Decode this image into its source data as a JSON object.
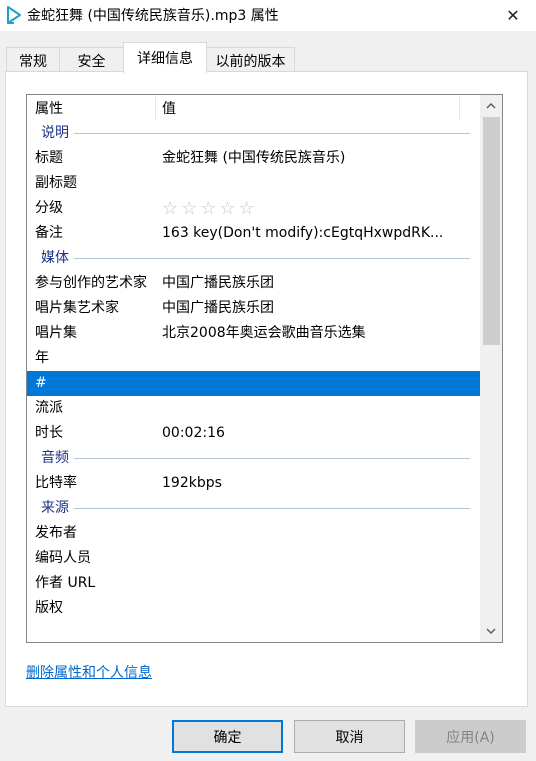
{
  "window": {
    "title": "金蛇狂舞 (中国传统民族音乐).mp3 属性",
    "close_glyph": "✕"
  },
  "tabs": [
    {
      "label": "常规",
      "active": false
    },
    {
      "label": "安全",
      "active": false
    },
    {
      "label": "详细信息",
      "active": true
    },
    {
      "label": "以前的版本",
      "active": false
    }
  ],
  "list": {
    "columns": {
      "property": "属性",
      "value": "值"
    },
    "groups": {
      "description": "说明",
      "media": "媒体",
      "audio": "音频",
      "origin": "来源"
    },
    "rows": {
      "title": {
        "k": "标题",
        "v": "金蛇狂舞 (中国传统民族音乐)"
      },
      "subtitle": {
        "k": "副标题",
        "v": ""
      },
      "rating": {
        "k": "分级",
        "stars": "☆☆☆☆☆"
      },
      "comments": {
        "k": "备注",
        "v": "163 key(Don't modify):cEgtqHxwpdRK..."
      },
      "contributing_artists": {
        "k": "参与创作的艺术家",
        "v": "中国广播民族乐团"
      },
      "album_artist": {
        "k": "唱片集艺术家",
        "v": "中国广播民族乐团"
      },
      "album": {
        "k": "唱片集",
        "v": "北京2008年奥运会歌曲音乐选集"
      },
      "year": {
        "k": "年",
        "v": ""
      },
      "track": {
        "k": "#",
        "v": ""
      },
      "genre": {
        "k": "流派",
        "v": ""
      },
      "length": {
        "k": "时长",
        "v": "00:02:16"
      },
      "bitrate": {
        "k": "比特率",
        "v": "192kbps"
      },
      "publisher": {
        "k": "发布者",
        "v": ""
      },
      "encoded_by": {
        "k": "编码人员",
        "v": ""
      },
      "author_url": {
        "k": "作者 URL",
        "v": ""
      },
      "copyright": {
        "k": "版权",
        "v": ""
      }
    }
  },
  "link": {
    "remove_properties": "删除属性和个人信息"
  },
  "buttons": {
    "ok": "确定",
    "cancel": "取消",
    "apply": "应用(A)"
  },
  "colors": {
    "selection": "#0078d7",
    "group_text": "#1e3287",
    "link": "#0066cc"
  }
}
